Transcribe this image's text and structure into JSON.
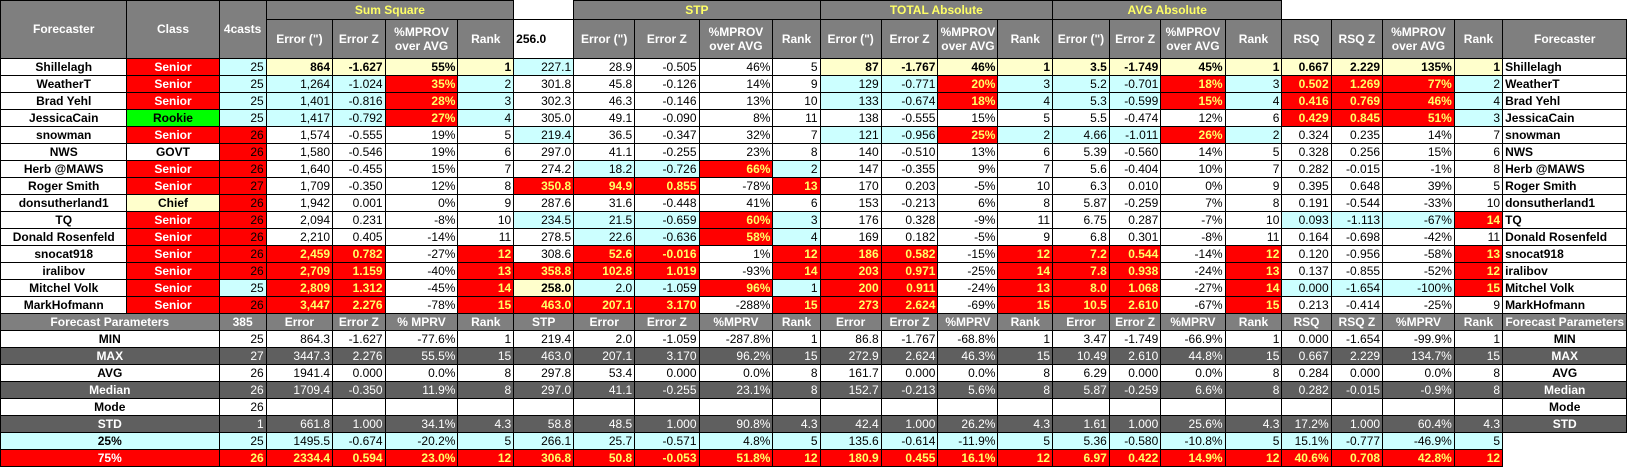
{
  "colors": {
    "yellow": "#ffffcc",
    "blue": "#ccffff",
    "red": "#ff0000",
    "green": "#00ff00",
    "gray": "#7f7f7f",
    "dark": "#5f5f5f",
    "headerText": "#ffff66"
  },
  "header": {
    "forecaster": "Forecaster",
    "class": "Class",
    "forecasts": "4casts",
    "groups": [
      "Sum Square",
      "STP",
      "TOTAL Absolute",
      "AVG Absolute"
    ],
    "stp_value": "256.0",
    "sub": {
      "err": "Error (\")",
      "errz": "Error Z",
      "mprov": "%MPROV over AVG",
      "rank": "Rank",
      "rsq": "RSQ",
      "rsqz": "RSQ Z"
    }
  },
  "rows": [
    {
      "cells": [
        "Shillelagh",
        "Senior",
        "25",
        "864",
        "-1.627",
        "55%",
        "1",
        "227.1",
        "28.9",
        "-0.505",
        "46%",
        "5",
        "87",
        "-1.767",
        "46%",
        "1",
        "3.5",
        "-1.749",
        "45%",
        "1",
        "0.667",
        "2.229",
        "135%",
        "1",
        "Shillelagh"
      ],
      "bg": [
        "",
        "R",
        "B",
        "Y",
        "Y",
        "Y",
        "Y",
        "B",
        "",
        "",
        "",
        "",
        "Y",
        "Y",
        "Y",
        "Y",
        "Y",
        "Y",
        "Y",
        "Y",
        "Y",
        "Y",
        "Y",
        "Y",
        ""
      ]
    },
    {
      "cells": [
        "WeatherT",
        "Senior",
        "25",
        "1,264",
        "-1.024",
        "35%",
        "2",
        "301.8",
        "45.8",
        "-0.126",
        "14%",
        "9",
        "129",
        "-0.771",
        "20%",
        "3",
        "5.2",
        "-0.701",
        "18%",
        "3",
        "0.502",
        "1.269",
        "77%",
        "2",
        "WeatherT"
      ],
      "bg": [
        "",
        "R",
        "B",
        "B",
        "B",
        "R",
        "B",
        "",
        "",
        "",
        "",
        "",
        "B",
        "B",
        "R",
        "B",
        "B",
        "B",
        "R",
        "B",
        "R",
        "R",
        "R",
        "B",
        ""
      ]
    },
    {
      "cells": [
        "Brad Yehl",
        "Senior",
        "25",
        "1,401",
        "-0.816",
        "28%",
        "3",
        "302.3",
        "46.3",
        "-0.146",
        "13%",
        "10",
        "133",
        "-0.674",
        "18%",
        "4",
        "5.3",
        "-0.599",
        "15%",
        "4",
        "0.416",
        "0.769",
        "46%",
        "4",
        "Brad Yehl"
      ],
      "bg": [
        "",
        "R",
        "B",
        "B",
        "B",
        "R",
        "B",
        "",
        "",
        "",
        "",
        "",
        "B",
        "B",
        "R",
        "B",
        "B",
        "B",
        "R",
        "B",
        "R",
        "R",
        "R",
        "B",
        ""
      ]
    },
    {
      "cells": [
        "JessicaCain",
        "Rookie",
        "25",
        "1,417",
        "-0.792",
        "27%",
        "4",
        "305.0",
        "49.1",
        "-0.090",
        "8%",
        "11",
        "138",
        "-0.555",
        "15%",
        "5",
        "5.5",
        "-0.474",
        "12%",
        "6",
        "0.429",
        "0.845",
        "51%",
        "3",
        "JessicaCain"
      ],
      "bg": [
        "",
        "G",
        "B",
        "B",
        "B",
        "R",
        "B",
        "",
        "",
        "",
        "",
        "",
        "",
        "",
        "",
        "",
        "",
        "",
        "",
        "",
        "R",
        "R",
        "R",
        "B",
        ""
      ]
    },
    {
      "cells": [
        "snowman",
        "Senior",
        "26",
        "1,574",
        "-0.555",
        "19%",
        "5",
        "219.4",
        "36.5",
        "-0.347",
        "32%",
        "7",
        "121",
        "-0.956",
        "25%",
        "2",
        "4.66",
        "-1.011",
        "26%",
        "2",
        "0.324",
        "0.235",
        "14%",
        "7",
        "snowman"
      ],
      "bg": [
        "",
        "R",
        "R",
        "",
        "",
        "",
        "",
        "B",
        "",
        "",
        "",
        "",
        "B",
        "B",
        "R",
        "B",
        "B",
        "B",
        "R",
        "B",
        "",
        "",
        "",
        "",
        ""
      ]
    },
    {
      "cells": [
        "NWS",
        "GOVT",
        "26",
        "1,580",
        "-0.546",
        "19%",
        "6",
        "297.0",
        "41.1",
        "-0.255",
        "23%",
        "8",
        "140",
        "-0.510",
        "13%",
        "6",
        "5.39",
        "-0.560",
        "14%",
        "5",
        "0.328",
        "0.256",
        "15%",
        "6",
        "NWS"
      ],
      "bg": [
        "",
        "",
        "R",
        "",
        "",
        "",
        "",
        "",
        "",
        "",
        "",
        "",
        "",
        "",
        "",
        "",
        "",
        "",
        "",
        "",
        "",
        "",
        "",
        "",
        ""
      ]
    },
    {
      "cells": [
        "Herb @MAWS",
        "Senior",
        "26",
        "1,640",
        "-0.455",
        "15%",
        "7",
        "274.2",
        "18.2",
        "-0.726",
        "66%",
        "2",
        "147",
        "-0.355",
        "9%",
        "7",
        "5.6",
        "-0.404",
        "10%",
        "7",
        "0.282",
        "-0.015",
        "-1%",
        "8",
        "Herb @MAWS"
      ],
      "bg": [
        "",
        "R",
        "R",
        "",
        "",
        "",
        "",
        "",
        "B",
        "B",
        "R",
        "B",
        "",
        "",
        "",
        "",
        "",
        "",
        "",
        "",
        "",
        "",
        "",
        "",
        ""
      ]
    },
    {
      "cells": [
        "Roger Smith",
        "Senior",
        "27",
        "1,709",
        "-0.350",
        "12%",
        "8",
        "350.8",
        "94.9",
        "0.855",
        "-78%",
        "13",
        "170",
        "0.203",
        "-5%",
        "10",
        "6.3",
        "0.010",
        "0%",
        "9",
        "0.395",
        "0.648",
        "39%",
        "5",
        "Roger Smith"
      ],
      "bg": [
        "",
        "R",
        "R",
        "",
        "",
        "",
        "",
        "R",
        "R",
        "R",
        "",
        "R",
        "",
        "",
        "",
        "",
        "",
        "",
        "",
        "",
        "",
        "",
        "",
        "",
        ""
      ]
    },
    {
      "cells": [
        "donsutherland1",
        "Chief",
        "26",
        "1,942",
        "0.001",
        "0%",
        "9",
        "287.6",
        "31.6",
        "-0.448",
        "41%",
        "6",
        "153",
        "-0.213",
        "6%",
        "8",
        "5.87",
        "-0.259",
        "7%",
        "8",
        "0.191",
        "-0.544",
        "-33%",
        "10",
        "donsutherland1"
      ],
      "bg": [
        "",
        "Y",
        "R",
        "",
        "",
        "",
        "",
        "",
        "",
        "",
        "",
        "",
        "",
        "",
        "",
        "",
        "",
        "",
        "",
        "",
        "",
        "",
        "",
        "",
        ""
      ]
    },
    {
      "cells": [
        "TQ",
        "Senior",
        "26",
        "2,094",
        "0.231",
        "-8%",
        "10",
        "234.5",
        "21.5",
        "-0.659",
        "60%",
        "3",
        "176",
        "0.328",
        "-9%",
        "11",
        "6.75",
        "0.287",
        "-7%",
        "10",
        "0.093",
        "-1.113",
        "-67%",
        "14",
        "TQ"
      ],
      "bg": [
        "",
        "R",
        "R",
        "",
        "",
        "",
        "",
        "B",
        "B",
        "B",
        "R",
        "B",
        "",
        "",
        "",
        "",
        "",
        "",
        "",
        "",
        "B",
        "B",
        "B",
        "R",
        ""
      ]
    },
    {
      "cells": [
        "Donald Rosenfeld",
        "Senior",
        "26",
        "2,210",
        "0.405",
        "-14%",
        "11",
        "278.5",
        "22.6",
        "-0.636",
        "58%",
        "4",
        "169",
        "0.182",
        "-5%",
        "9",
        "6.8",
        "0.301",
        "-8%",
        "11",
        "0.164",
        "-0.698",
        "-42%",
        "11",
        "Donald Rosenfeld"
      ],
      "bg": [
        "",
        "R",
        "R",
        "",
        "",
        "",
        "",
        "",
        "B",
        "B",
        "R",
        "B",
        "",
        "",
        "",
        "",
        "",
        "",
        "",
        "",
        "",
        "",
        "",
        "",
        ""
      ]
    },
    {
      "cells": [
        "snocat918",
        "Senior",
        "26",
        "2,459",
        "0.782",
        "-27%",
        "12",
        "308.6",
        "52.6",
        "-0.016",
        "1%",
        "12",
        "186",
        "0.582",
        "-15%",
        "12",
        "7.2",
        "0.544",
        "-14%",
        "12",
        "0.120",
        "-0.956",
        "-58%",
        "13",
        "snocat918"
      ],
      "bg": [
        "",
        "R",
        "R",
        "R",
        "R",
        "",
        "R",
        "",
        "R",
        "R",
        "",
        "R",
        "R",
        "R",
        "",
        "R",
        "R",
        "R",
        "",
        "R",
        "",
        "",
        "",
        "R",
        ""
      ]
    },
    {
      "cells": [
        "iralibov",
        "Senior",
        "26",
        "2,709",
        "1.159",
        "-40%",
        "13",
        "358.8",
        "102.8",
        "1.019",
        "-93%",
        "14",
        "203",
        "0.971",
        "-25%",
        "14",
        "7.8",
        "0.938",
        "-24%",
        "13",
        "0.137",
        "-0.855",
        "-52%",
        "12",
        "iralibov"
      ],
      "bg": [
        "",
        "R",
        "R",
        "R",
        "R",
        "",
        "R",
        "R",
        "R",
        "R",
        "",
        "R",
        "R",
        "R",
        "",
        "R",
        "R",
        "R",
        "",
        "R",
        "",
        "",
        "",
        "R",
        ""
      ]
    },
    {
      "cells": [
        "Mitchel Volk",
        "Senior",
        "25",
        "2,809",
        "1.312",
        "-45%",
        "14",
        "258.0",
        "2.0",
        "-1.059",
        "96%",
        "1",
        "200",
        "0.911",
        "-24%",
        "13",
        "8.0",
        "1.068",
        "-27%",
        "14",
        "0.000",
        "-1.654",
        "-100%",
        "15",
        "Mitchel Volk"
      ],
      "bg": [
        "",
        "R",
        "B",
        "R",
        "R",
        "",
        "R",
        "Y",
        "B",
        "B",
        "R",
        "B",
        "R",
        "R",
        "",
        "R",
        "R",
        "R",
        "",
        "R",
        "B",
        "B",
        "B",
        "R",
        ""
      ]
    },
    {
      "cells": [
        "MarkHofmann",
        "Senior",
        "26",
        "3,447",
        "2.276",
        "-78%",
        "15",
        "463.0",
        "207.1",
        "3.170",
        "-288%",
        "15",
        "273",
        "2.624",
        "-69%",
        "15",
        "10.5",
        "2.610",
        "-67%",
        "15",
        "0.213",
        "-0.414",
        "-25%",
        "9",
        "MarkHofmann"
      ],
      "bg": [
        "",
        "R",
        "R",
        "R",
        "R",
        "",
        "R",
        "R",
        "R",
        "R",
        "",
        "R",
        "R",
        "R",
        "",
        "R",
        "R",
        "R",
        "",
        "R",
        "",
        "",
        "",
        "",
        ""
      ]
    }
  ],
  "param_header": [
    "Forecast Parameters",
    "385",
    "Error",
    "Error Z",
    "% MPRV",
    "Rank",
    "STP",
    "Error",
    "Error Z",
    "%MPRV",
    "Rank",
    "Error",
    "Error Z",
    "%MPRV",
    "Rank",
    "Error",
    "Error Z",
    "%MPRV",
    "Rank",
    "RSQ",
    "RSQ Z",
    "%MPRV",
    "Rank",
    "Forecast Parameters"
  ],
  "stats": [
    {
      "cells": [
        "MIN",
        "25",
        "864.3",
        "-1.627",
        "-77.6%",
        "1",
        "219.4",
        "2.0",
        "-1.059",
        "-287.8%",
        "1",
        "86.8",
        "-1.767",
        "-68.8%",
        "1",
        "3.47",
        "-1.749",
        "-66.9%",
        "1",
        "0.000",
        "-1.654",
        "-99.9%",
        "1",
        "MIN"
      ],
      "style": "w"
    },
    {
      "cells": [
        "MAX",
        "27",
        "3447.3",
        "2.276",
        "55.5%",
        "15",
        "463.0",
        "207.1",
        "3.170",
        "96.2%",
        "15",
        "272.9",
        "2.624",
        "46.3%",
        "15",
        "10.49",
        "2.610",
        "44.8%",
        "15",
        "0.667",
        "2.229",
        "134.7%",
        "15",
        "MAX"
      ],
      "style": "d"
    },
    {
      "cells": [
        "AVG",
        "26",
        "1941.4",
        "0.000",
        "0.0%",
        "8",
        "297.8",
        "53.4",
        "0.000",
        "0.0%",
        "8",
        "161.7",
        "0.000",
        "0.0%",
        "8",
        "6.29",
        "0.000",
        "0.0%",
        "8",
        "0.284",
        "0.000",
        "0.0%",
        "8",
        "AVG"
      ],
      "style": "w"
    },
    {
      "cells": [
        "Median",
        "26",
        "1709.4",
        "-0.350",
        "11.9%",
        "8",
        "297.0",
        "41.1",
        "-0.255",
        "23.1%",
        "8",
        "152.7",
        "-0.213",
        "5.6%",
        "8",
        "5.87",
        "-0.259",
        "6.6%",
        "8",
        "0.282",
        "-0.015",
        "-0.9%",
        "8",
        "Median"
      ],
      "style": "d"
    },
    {
      "cells": [
        "Mode",
        "26",
        "",
        "",
        "",
        "",
        "",
        "",
        "",
        "",
        "",
        "",
        "",
        "",
        "",
        "",
        "",
        "",
        "",
        "",
        "",
        "",
        "",
        "Mode"
      ],
      "style": "w"
    },
    {
      "cells": [
        "STD",
        "1",
        "661.8",
        "1.000",
        "34.1%",
        "4.3",
        "58.8",
        "48.5",
        "1.000",
        "90.8%",
        "4.3",
        "42.4",
        "1.000",
        "26.2%",
        "4.3",
        "1.61",
        "1.000",
        "25.6%",
        "4.3",
        "17.2%",
        "1.000",
        "60.4%",
        "4.3",
        "STD"
      ],
      "style": "d"
    },
    {
      "cells": [
        "25%",
        "25",
        "1495.5",
        "-0.674",
        "-20.2%",
        "5",
        "266.1",
        "25.7",
        "-0.571",
        "4.8%",
        "5",
        "135.6",
        "-0.614",
        "-11.9%",
        "5",
        "5.36",
        "-0.580",
        "-10.8%",
        "5",
        "15.1%",
        "-0.777",
        "-46.9%",
        "5",
        ""
      ],
      "style": "b"
    },
    {
      "cells": [
        "75%",
        "26",
        "2334.4",
        "0.594",
        "23.0%",
        "12",
        "306.8",
        "50.8",
        "-0.053",
        "51.8%",
        "12",
        "180.9",
        "0.455",
        "16.1%",
        "12",
        "6.97",
        "0.422",
        "14.9%",
        "12",
        "40.6%",
        "0.708",
        "42.8%",
        "12",
        ""
      ],
      "style": "r"
    }
  ]
}
